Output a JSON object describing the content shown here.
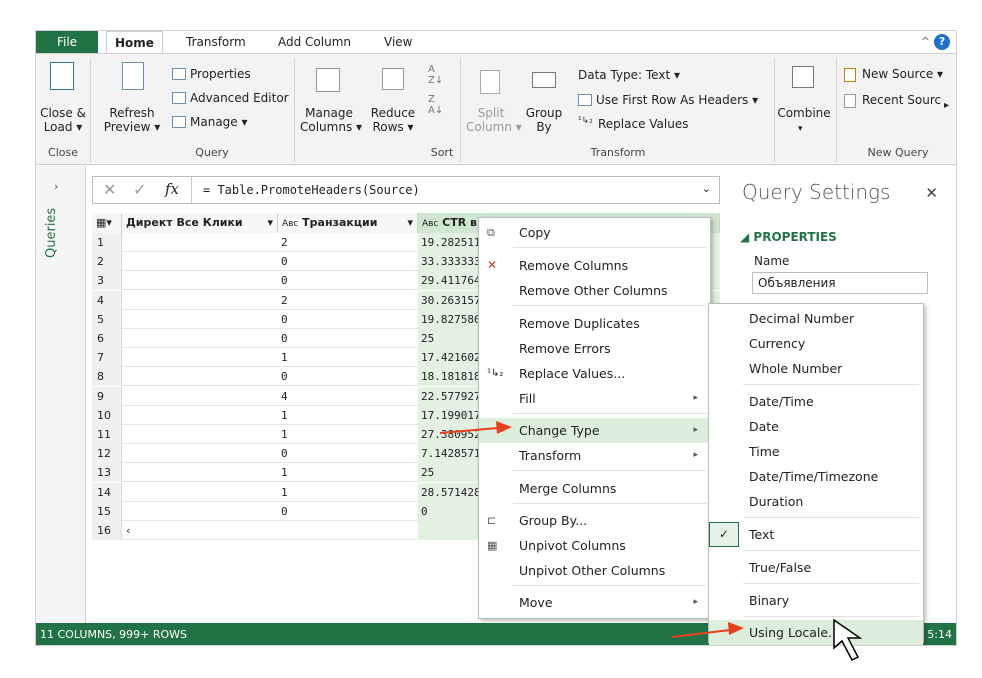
{
  "tabs": [
    "File",
    "Home",
    "Transform",
    "Add Column",
    "View"
  ],
  "ribbon": {
    "close_load": "Close &\nLoad ▾",
    "refresh": "Refresh\nPreview ▾",
    "properties": "Properties",
    "advanced_editor": "Advanced Editor",
    "manage": "Manage ▾",
    "manage_columns": "Manage\nColumns ▾",
    "reduce_rows": "Reduce\nRows ▾",
    "split_column": "Split\nColumn ▾",
    "group_by": "Group\nBy",
    "data_type": "Data Type: Text ▾",
    "use_first_row": "Use First Row As Headers ▾",
    "replace_values": "Replace Values",
    "combine": "Combine",
    "new_source": "New Source ▾",
    "recent_sources": "Recent Sourc",
    "groups": {
      "close": "Close",
      "query": "Query",
      "sort": "Sort",
      "transform": "Transform",
      "new_query": "New Query"
    }
  },
  "side": {
    "queries": "Queries"
  },
  "formula": {
    "fx": "fx",
    "text": "= Table.PromoteHeaders(Source)"
  },
  "columns": [
    "Директ Все Клики",
    "Транзакции",
    "CTR в"
  ],
  "col_type_icons": {
    "c2": "Aʙᴄ",
    "c3": "Aʙᴄ"
  },
  "rows": [
    {
      "n": "1",
      "a": "",
      "b": "2",
      "c": "19.282511"
    },
    {
      "n": "2",
      "a": "",
      "b": "0",
      "c": "33.333333"
    },
    {
      "n": "3",
      "a": "",
      "b": "0",
      "c": "29.411764"
    },
    {
      "n": "4",
      "a": "",
      "b": "2",
      "c": "30.263157"
    },
    {
      "n": "5",
      "a": "",
      "b": "0",
      "c": "19.827586"
    },
    {
      "n": "6",
      "a": "",
      "b": "0",
      "c": "25"
    },
    {
      "n": "7",
      "a": "",
      "b": "1",
      "c": "17.421602"
    },
    {
      "n": "8",
      "a": "",
      "b": "0",
      "c": "18.181818"
    },
    {
      "n": "9",
      "a": "",
      "b": "4",
      "c": "22.577927"
    },
    {
      "n": "10",
      "a": "",
      "b": "1",
      "c": "17.199017"
    },
    {
      "n": "11",
      "a": "",
      "b": "1",
      "c": "27.380952"
    },
    {
      "n": "12",
      "a": "",
      "b": "0",
      "c": "7.1428571"
    },
    {
      "n": "13",
      "a": "",
      "b": "1",
      "c": "25"
    },
    {
      "n": "14",
      "a": "",
      "b": "1",
      "c": "28.571428"
    },
    {
      "n": "15",
      "a": "",
      "b": "0",
      "c": "0"
    },
    {
      "n": "16",
      "a": "",
      "b": "",
      "c": ""
    }
  ],
  "query_settings": {
    "title": "Query Settings",
    "properties": "◢ PROPERTIES",
    "name_label": "Name",
    "name_value": "Объявления"
  },
  "status": {
    "left": "11 COLUMNS, 999+ ROWS",
    "right": "5:14"
  },
  "context_menu": [
    "Copy",
    "Remove Columns",
    "Remove Other Columns",
    "Remove Duplicates",
    "Remove Errors",
    "Replace Values...",
    "Fill",
    "Change Type",
    "Transform",
    "Merge Columns",
    "Group By...",
    "Unpivot Columns",
    "Unpivot Other Columns",
    "Move"
  ],
  "submenu": [
    "Decimal Number",
    "Currency",
    "Whole Number",
    "Date/Time",
    "Date",
    "Time",
    "Date/Time/Timezone",
    "Duration",
    "Text",
    "True/False",
    "Binary",
    "Using Locale..."
  ],
  "colors": {
    "accent": "#217346",
    "highlight": "#ddeedd",
    "arrow": "#e8401c"
  }
}
